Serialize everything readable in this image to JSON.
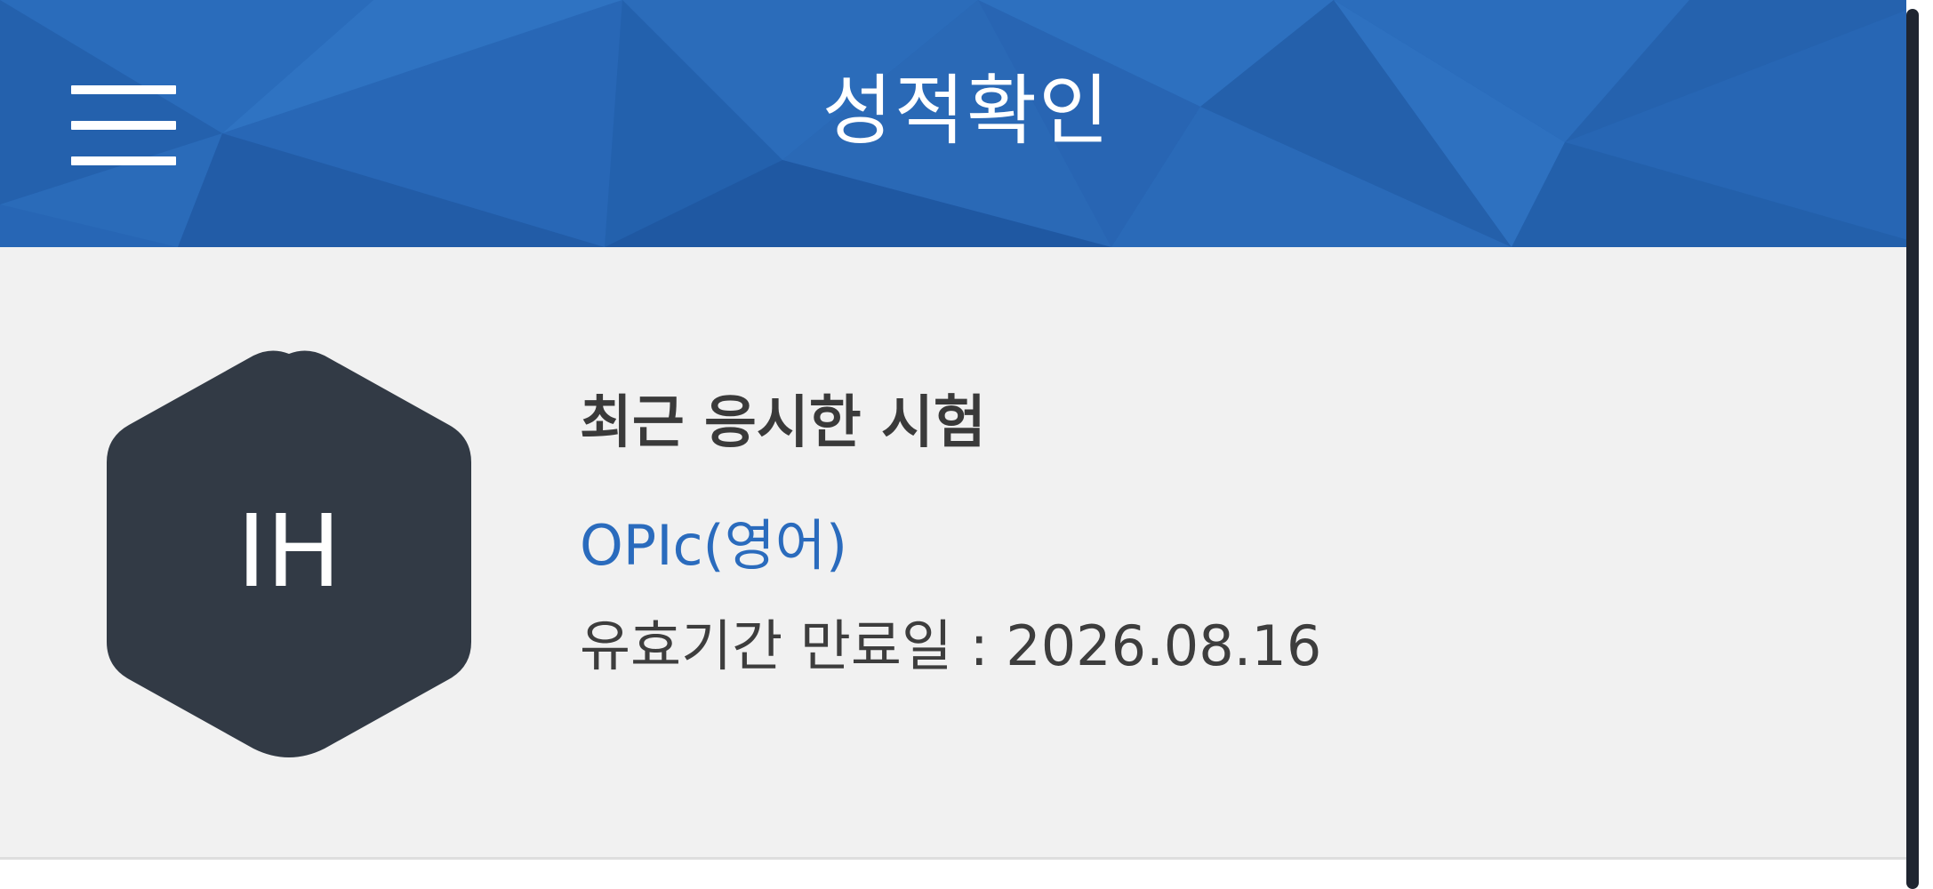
{
  "header": {
    "title": "성적확인",
    "menu_icon": "hamburger-menu-icon",
    "background_color": "#2766b5"
  },
  "recent_exam": {
    "heading": "최근 응시한 시험",
    "grade": "IH",
    "grade_badge_color": "#323a45",
    "exam_name": "OPIc(영어)",
    "exam_name_color": "#2a6bbd",
    "expiry_text": "유효기간 만료일 : 2026.08.16"
  }
}
